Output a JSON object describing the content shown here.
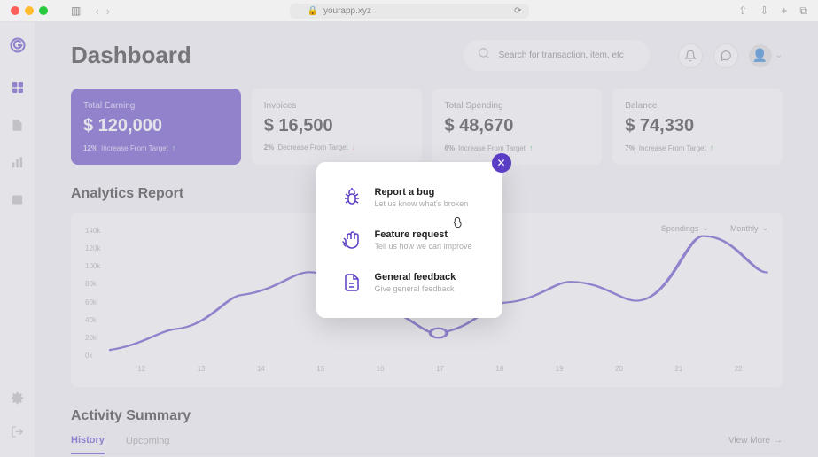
{
  "browser": {
    "url": "yourapp.xyz"
  },
  "header": {
    "title": "Dashboard",
    "search_placeholder": "Search for transaction, item, etc"
  },
  "cards": [
    {
      "label": "Total Earning",
      "value": "$ 120,000",
      "delta_pct": "12%",
      "delta_text": "Increase From Target",
      "primary": true
    },
    {
      "label": "Invoices",
      "value": "$ 16,500",
      "delta_pct": "2%",
      "delta_text": "Decrease From Target",
      "primary": false
    },
    {
      "label": "Total Spending",
      "value": "$ 48,670",
      "delta_pct": "6%",
      "delta_text": "Increase From Target",
      "primary": false
    },
    {
      "label": "Balance",
      "value": "$ 74,330",
      "delta_pct": "7%",
      "delta_text": "Increase From Target",
      "primary": false
    }
  ],
  "analytics": {
    "title": "Analytics Report",
    "filters": {
      "metric": "Spendings",
      "range": "Monthly"
    }
  },
  "chart_data": {
    "type": "line",
    "title": "Analytics Report",
    "xlabel": "",
    "ylabel": "",
    "ylim": [
      0,
      140
    ],
    "y_ticks": [
      "140k",
      "120k",
      "100k",
      "80k",
      "60k",
      "40k",
      "20k",
      "0k"
    ],
    "categories": [
      "12",
      "13",
      "14",
      "15",
      "16",
      "17",
      "18",
      "19",
      "20",
      "21",
      "22"
    ],
    "series": [
      {
        "name": "Spendings",
        "values": [
          10,
          30,
          65,
          90,
          55,
          25,
          55,
          80,
          60,
          130,
          90
        ]
      }
    ]
  },
  "activity": {
    "title": "Activity Summary",
    "tabs": [
      "History",
      "Upcoming"
    ],
    "active_tab": "History",
    "view_more": "View More"
  },
  "modal": {
    "items": [
      {
        "title": "Report a bug",
        "sub": "Let us know what's broken",
        "icon": "bug"
      },
      {
        "title": "Feature request",
        "sub": "Tell us how we can improve",
        "icon": "hand"
      },
      {
        "title": "General feedback",
        "sub": "Give general feedback",
        "icon": "doc"
      }
    ]
  },
  "colors": {
    "accent": "#5b3cc4"
  }
}
